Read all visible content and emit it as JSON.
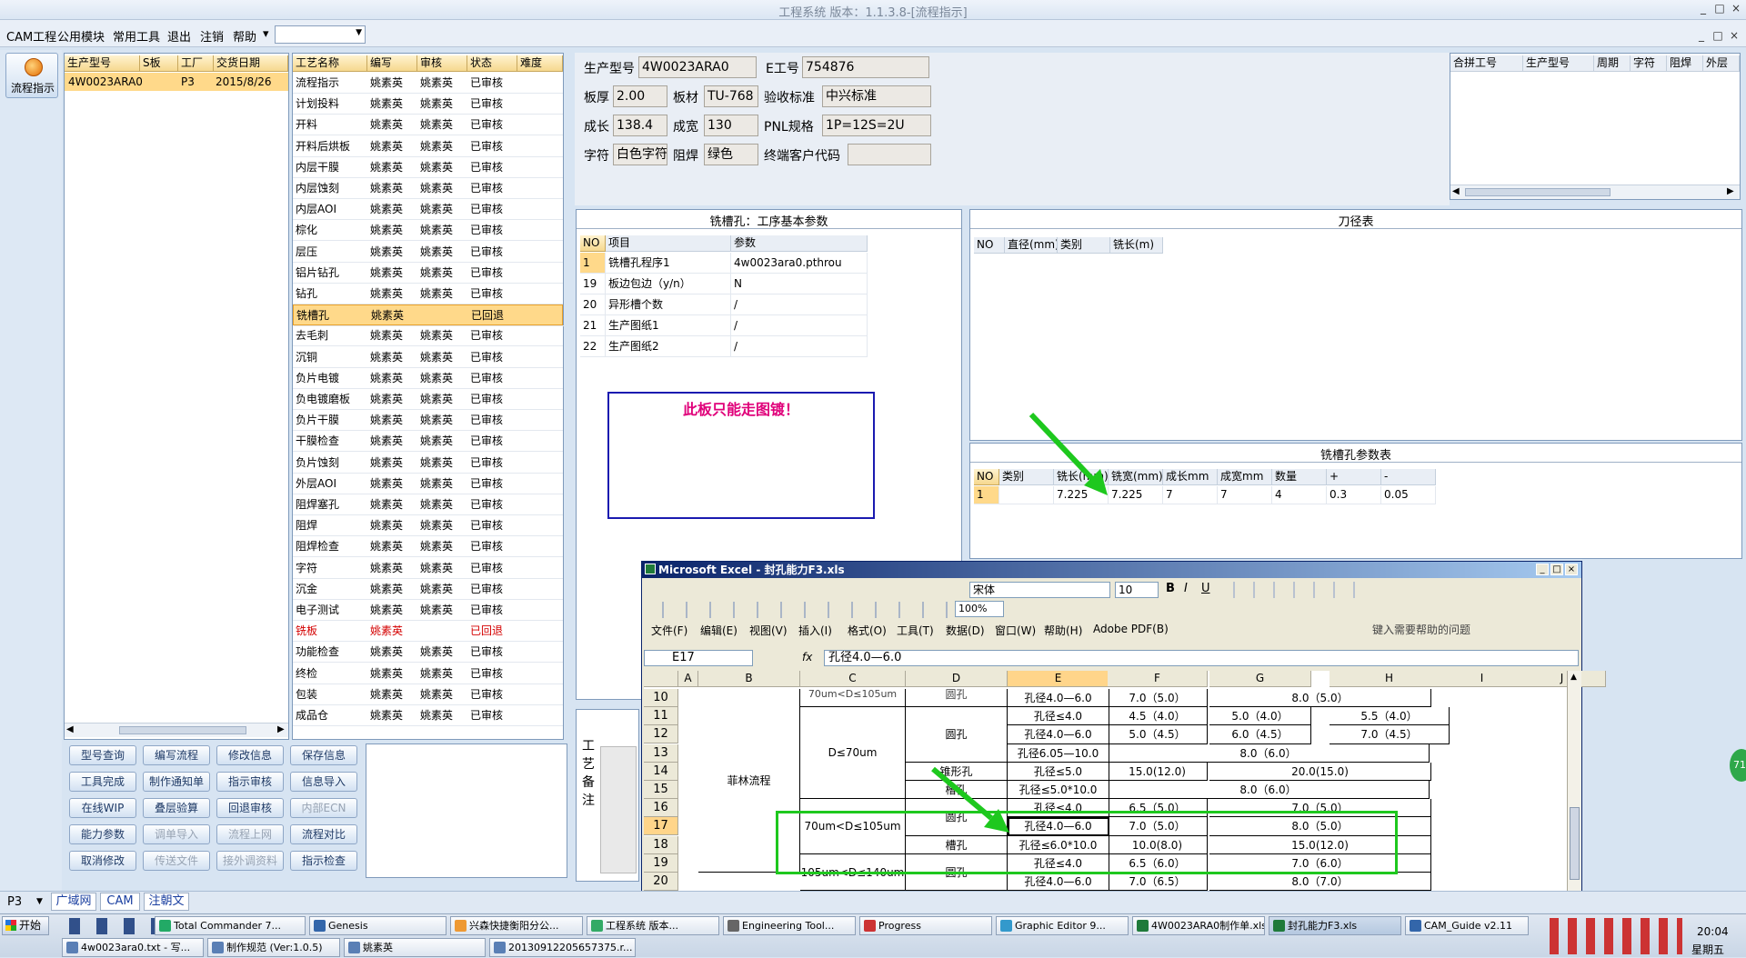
{
  "app": {
    "title": "工程系统 版本：1.1.3.8-[流程指示]",
    "window_btns": [
      "_",
      "□",
      "×"
    ],
    "inner_btns": [
      "_",
      "□",
      "×"
    ]
  },
  "menu": [
    "CAM工程",
    "公用模块",
    "常用工具",
    "退出",
    "注销",
    "帮助"
  ],
  "menu_help_arrow": "▾",
  "leftbar": {
    "flow_button": "流程指示"
  },
  "prod_table": {
    "headers": [
      "生产型号",
      "S板",
      "工厂",
      "交货日期"
    ],
    "rows": [
      [
        "4W0023ARA0",
        "",
        "P3",
        "2015/8/26"
      ]
    ]
  },
  "process_table": {
    "headers": [
      "工艺名称",
      "编写",
      "审核",
      "状态",
      "难度"
    ],
    "rows": [
      [
        "流程指示",
        "姚素英",
        "姚素英",
        "已审核",
        ""
      ],
      [
        "计划投料",
        "姚素英",
        "姚素英",
        "已审核",
        ""
      ],
      [
        "开料",
        "姚素英",
        "姚素英",
        "已审核",
        ""
      ],
      [
        "开料后烘板",
        "姚素英",
        "姚素英",
        "已审核",
        ""
      ],
      [
        "内层干膜",
        "姚素英",
        "姚素英",
        "已审核",
        ""
      ],
      [
        "内层蚀刻",
        "姚素英",
        "姚素英",
        "已审核",
        ""
      ],
      [
        "内层AOI",
        "姚素英",
        "姚素英",
        "已审核",
        ""
      ],
      [
        "棕化",
        "姚素英",
        "姚素英",
        "已审核",
        ""
      ],
      [
        "层压",
        "姚素英",
        "姚素英",
        "已审核",
        ""
      ],
      [
        "铝片钻孔",
        "姚素英",
        "姚素英",
        "已审核",
        ""
      ],
      [
        "钻孔",
        "姚素英",
        "姚素英",
        "已审核",
        ""
      ],
      [
        "铣槽孔",
        "姚素英",
        "",
        "已回退",
        ""
      ],
      [
        "去毛刺",
        "姚素英",
        "姚素英",
        "已审核",
        ""
      ],
      [
        "沉铜",
        "姚素英",
        "姚素英",
        "已审核",
        ""
      ],
      [
        "负片电镀",
        "姚素英",
        "姚素英",
        "已审核",
        ""
      ],
      [
        "负电镀磨板",
        "姚素英",
        "姚素英",
        "已审核",
        ""
      ],
      [
        "负片干膜",
        "姚素英",
        "姚素英",
        "已审核",
        ""
      ],
      [
        "干膜检查",
        "姚素英",
        "姚素英",
        "已审核",
        ""
      ],
      [
        "负片蚀刻",
        "姚素英",
        "姚素英",
        "已审核",
        ""
      ],
      [
        "外层AOI",
        "姚素英",
        "姚素英",
        "已审核",
        ""
      ],
      [
        "阻焊塞孔",
        "姚素英",
        "姚素英",
        "已审核",
        ""
      ],
      [
        "阻焊",
        "姚素英",
        "姚素英",
        "已审核",
        ""
      ],
      [
        "阻焊检查",
        "姚素英",
        "姚素英",
        "已审核",
        ""
      ],
      [
        "字符",
        "姚素英",
        "姚素英",
        "已审核",
        ""
      ],
      [
        "沉金",
        "姚素英",
        "姚素英",
        "已审核",
        ""
      ],
      [
        "电子测试",
        "姚素英",
        "姚素英",
        "已审核",
        ""
      ],
      [
        "铣板",
        "姚素英",
        "",
        "已回退",
        ""
      ],
      [
        "功能检查",
        "姚素英",
        "姚素英",
        "已审核",
        ""
      ],
      [
        "终检",
        "姚素英",
        "姚素英",
        "已审核",
        ""
      ],
      [
        "包装",
        "姚素英",
        "姚素英",
        "已审核",
        ""
      ],
      [
        "成品仓",
        "姚素英",
        "姚素英",
        "已审核",
        ""
      ]
    ]
  },
  "buttons": [
    [
      "型号查询",
      "编写流程",
      "修改信息",
      "保存信息"
    ],
    [
      "工具完成",
      "制作通知单",
      "指示审核",
      "信息导入"
    ],
    [
      "在线WIP",
      "叠层验算",
      "回退审核",
      "内部ECN"
    ],
    [
      "能力参数",
      "调单导入",
      "流程上网",
      "流程对比"
    ],
    [
      "取消修改",
      "传送文件",
      "接外调资料",
      "指示检查"
    ]
  ],
  "buttons_disabled": [
    "内部ECN",
    "调单导入",
    "流程上网",
    "传送文件",
    "接外调资料"
  ],
  "info": {
    "labels": [
      "生产型号",
      "E工号",
      "板厚",
      "板材",
      "验收标准",
      "成长",
      "成宽",
      "PNL规格",
      "字符",
      "阻焊",
      "终端客户代码"
    ],
    "values": {
      "prod": "4W0023ARA0",
      "eno": "754876",
      "thick": "2.00",
      "mat": "TU-768",
      "std": "中兴标准",
      "len": "138.4",
      "wid": "130",
      "pnl": "1P=12S=2U",
      "char": "白色字符",
      "mask": "绿色",
      "cust": ""
    }
  },
  "merge_table": {
    "headers": [
      "合拼工号",
      "生产型号",
      "周期",
      "字符",
      "阻焊",
      "外层"
    ]
  },
  "param_panel": {
    "title": "铣槽孔：工序基本参数",
    "headers": [
      "NO",
      "项目",
      "参数"
    ],
    "rows": [
      [
        "1",
        "铣槽孔程序1",
        "4w0023ara0.pthrou"
      ],
      [
        "19",
        "板边包边（y/n）",
        "N"
      ],
      [
        "20",
        "异形槽个数",
        "/"
      ],
      [
        "21",
        "生产图纸1",
        "/"
      ],
      [
        "22",
        "生产图纸2",
        "/"
      ]
    ],
    "note": "此板只能走图镀！"
  },
  "tool_panel": {
    "title": "刀径表",
    "headers": [
      "NO",
      "直径(mm)",
      "类别",
      "铣长(m)"
    ]
  },
  "slot_panel": {
    "title": "铣槽孔参数表",
    "headers": [
      "NO",
      "类别",
      "铣长(mm)",
      "铣宽(mm)",
      "成长mm",
      "成宽mm",
      "数量",
      "+",
      "-"
    ],
    "rows": [
      [
        "1",
        "",
        "7.225",
        "7.225",
        "7",
        "7",
        "4",
        "0.3",
        "0.05"
      ]
    ]
  },
  "craft_note": [
    "工",
    "艺",
    "备",
    "注"
  ],
  "excel": {
    "title": "Microsoft Excel - 封孔能力F3.xls",
    "font": "宋体",
    "size": "10",
    "zoom": "100%",
    "menus": [
      "文件(F)",
      "编辑(E)",
      "视图(V)",
      "插入(I)",
      "格式(O)",
      "工具(T)",
      "数据(D)",
      "窗口(W)",
      "帮助(H)",
      "Adobe PDF(B)"
    ],
    "help_placeholder": "键入需要帮助的问题",
    "cellref": "E17",
    "fx": "fx",
    "formula": "孔径4.0—6.0",
    "cols": [
      "A",
      "B",
      "C",
      "D",
      "E",
      "F",
      "G",
      "H",
      "I",
      "J"
    ],
    "rownums": [
      "10",
      "11",
      "12",
      "13",
      "14",
      "15",
      "16",
      "17",
      "18",
      "19",
      "20"
    ],
    "cells": {
      "b_flow": "菲林流程",
      "c_a": "70um<D≤105um",
      "c_b": "D≤70um",
      "c_c": "70um<D≤105um",
      "c_d": "105um<D≤140um",
      "d_a": "圆孔",
      "d_b": "圆孔",
      "d_c": "锥形孔",
      "d_d": "槽孔",
      "d_e": "圆孔",
      "d_f": "槽孔",
      "d_g": "圆孔",
      "e": [
        "孔径4.0—6.0",
        "孔径≤4.0",
        "孔径4.0—6.0",
        "孔径6.05—10.0",
        "孔径≤5.0",
        "孔径≤5.0*10.0",
        "孔径≤4.0",
        "孔径4.0—6.0",
        "孔径≤6.0*10.0",
        "孔径≤4.0",
        "孔径4.0—6.0"
      ],
      "f": [
        "7.0（5.0）",
        "4.5（4.0）",
        "5.0（4.5）",
        "",
        "15.0(12.0)",
        "",
        "6.5（5.0）",
        "7.0（5.0）",
        "10.0(8.0)",
        "6.5（6.0）",
        "7.0（6.5）"
      ],
      "g": [
        "8.0（5.0）",
        "5.0（4.0）",
        "6.0（4.5）",
        "8.0（6.0）",
        "20.0(15.0)",
        "8.0（6.0）",
        "7.0（5.0）",
        "8.0（5.0）",
        "15.0(12.0)",
        "7.0（6.0）",
        "8.0（7.0）"
      ],
      "h": [
        "",
        "5.5（4.0）",
        "7.0（4.5）"
      ]
    }
  },
  "bottom_tabs": [
    "P3",
    "广域网",
    "CAM",
    "注朝文"
  ],
  "taskbar": {
    "start": "开始",
    "row1": [
      "Total Commander 7...",
      "Genesis",
      "兴森快捷衡阳分公...",
      "工程系统 版本...",
      "Engineering Tool...",
      "Progress",
      "Graphic Editor 9...",
      "4W0023ARA0制作单.xls",
      "封孔能力F3.xls",
      "CAM_Guide v2.11"
    ],
    "row2": [
      "4w0023ara0.txt - 写...",
      "制作规范 (Ver:1.0.5)",
      "姚素英",
      "20130912205657375.r..."
    ],
    "clock": "20:04",
    "weekday": "星期五"
  },
  "floating_badge": "71",
  "colors": {
    "accent": "#f6d88e",
    "selected_row": "#ffd98a",
    "highlight": "#1ec81e",
    "note_border": "#1a1ab0",
    "note_text": "#e0007a",
    "reverted": "#d40000"
  }
}
